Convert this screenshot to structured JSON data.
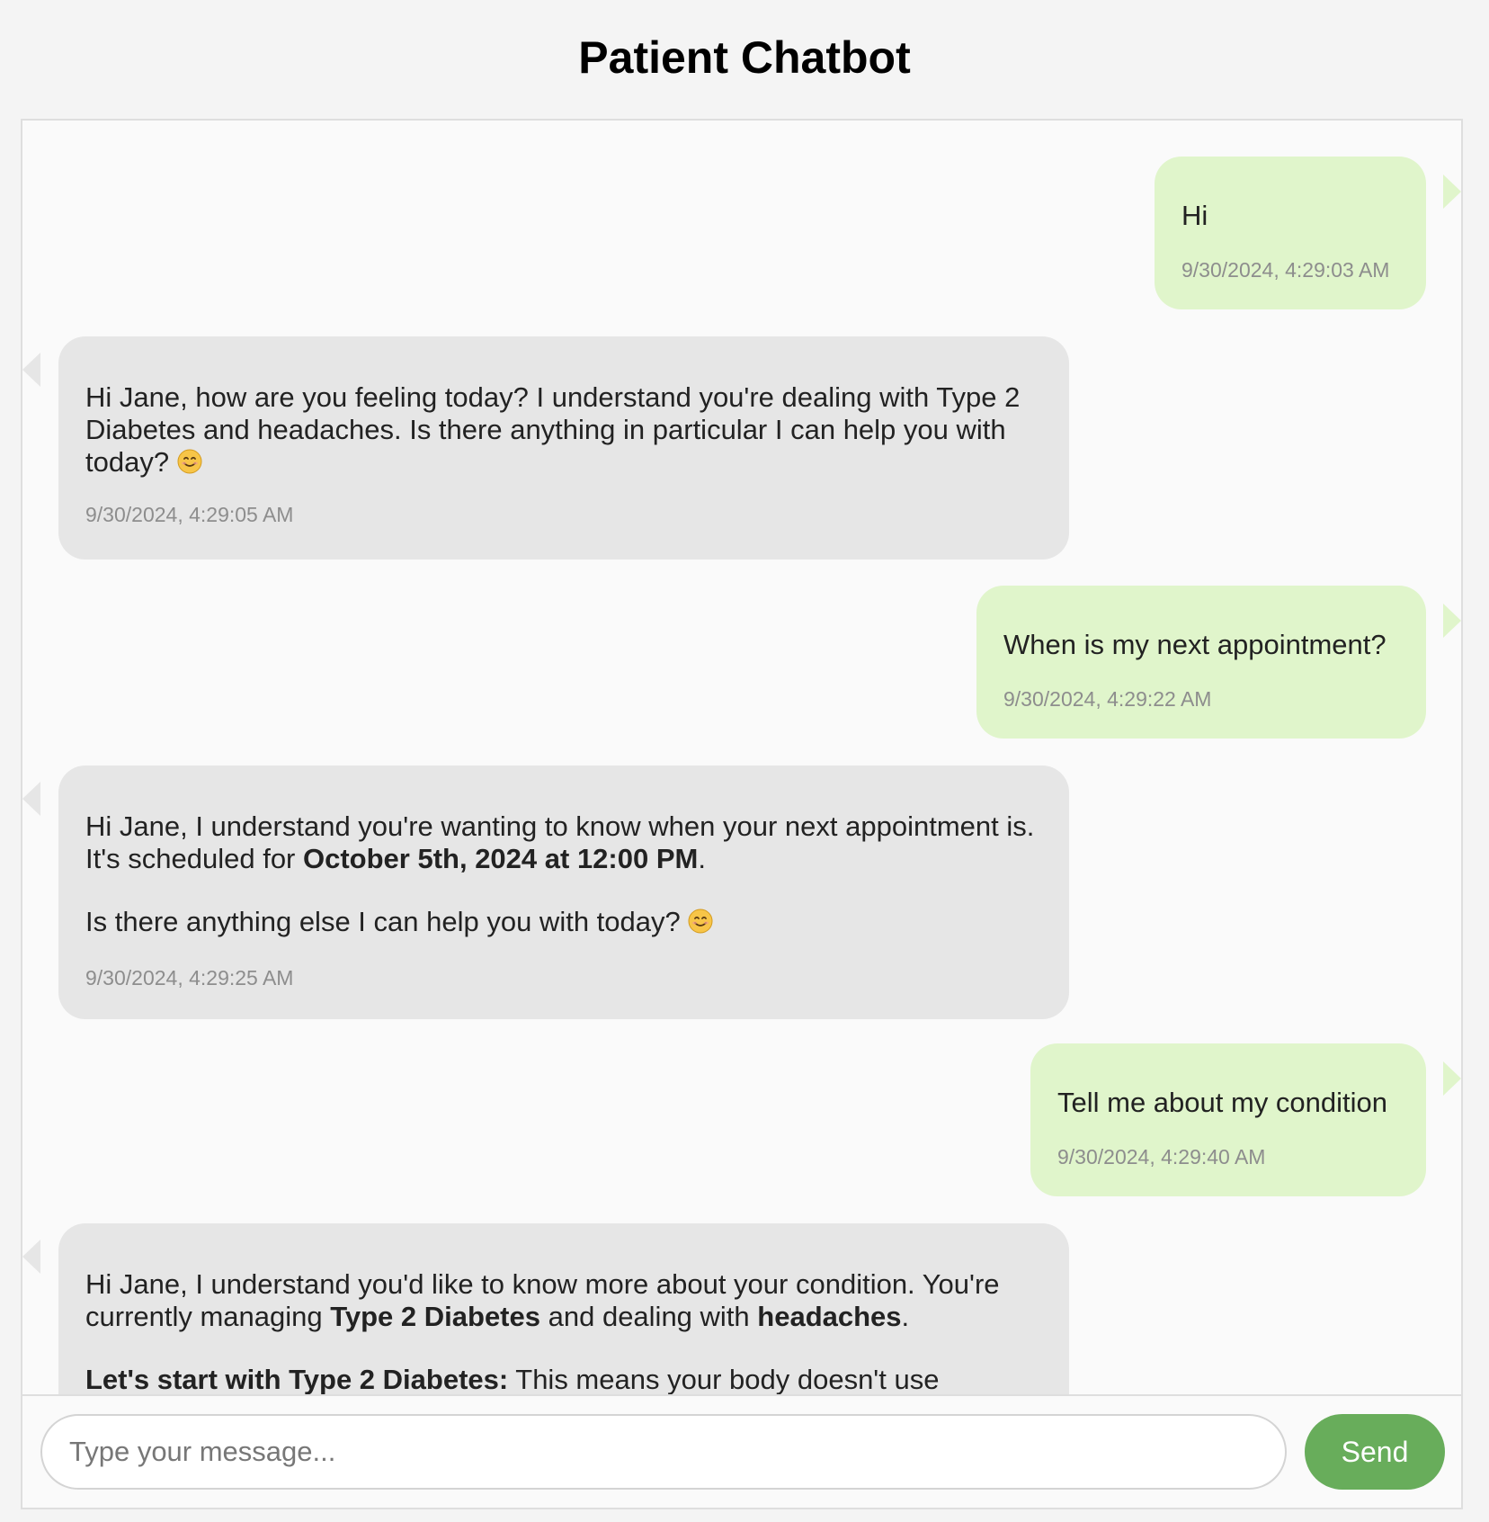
{
  "page": {
    "title": "Patient Chatbot"
  },
  "messages": [
    {
      "sender": "user",
      "text": "Hi",
      "time": "9/30/2024, 4:29:03 AM"
    },
    {
      "sender": "bot",
      "line1": "Hi Jane, how are you feeling today? I understand you're dealing with Type 2 Diabetes and headaches. Is there anything in particular I can help you with today?",
      "emoji": "smiling-face-emoji",
      "time": "9/30/2024, 4:29:05 AM"
    },
    {
      "sender": "user",
      "text": "When is my next appointment?",
      "time": "9/30/2024, 4:29:22 AM"
    },
    {
      "sender": "bot",
      "p1_pre": "Hi Jane, I understand you're wanting to know when your next appointment is. It's scheduled for ",
      "p1_bold": "October 5th, 2024 at 12:00 PM",
      "p1_post": ".",
      "p2": "Is there anything else I can help you with today?",
      "emoji": "smiling-face-emoji",
      "time": "9/30/2024, 4:29:25 AM"
    },
    {
      "sender": "user",
      "text": "Tell me about my condition",
      "time": "9/30/2024, 4:29:40 AM"
    },
    {
      "sender": "bot",
      "p1_pre": "Hi Jane, I understand you'd like to know more about your condition. You're currently managing ",
      "p1_bold1": "Type 2 Diabetes",
      "p1_mid": " and dealing with ",
      "p1_bold2": "headaches",
      "p1_post": ".",
      "p2_bold": "Let's start with Type 2 Diabetes:",
      "p2_rest": " This means your body doesn't use"
    }
  ],
  "composer": {
    "placeholder": "Type your message...",
    "send_label": "Send"
  },
  "colors": {
    "user_bubble": "#e0f5cb",
    "bot_bubble": "#e6e6e6",
    "send_button": "#68ad5b"
  }
}
